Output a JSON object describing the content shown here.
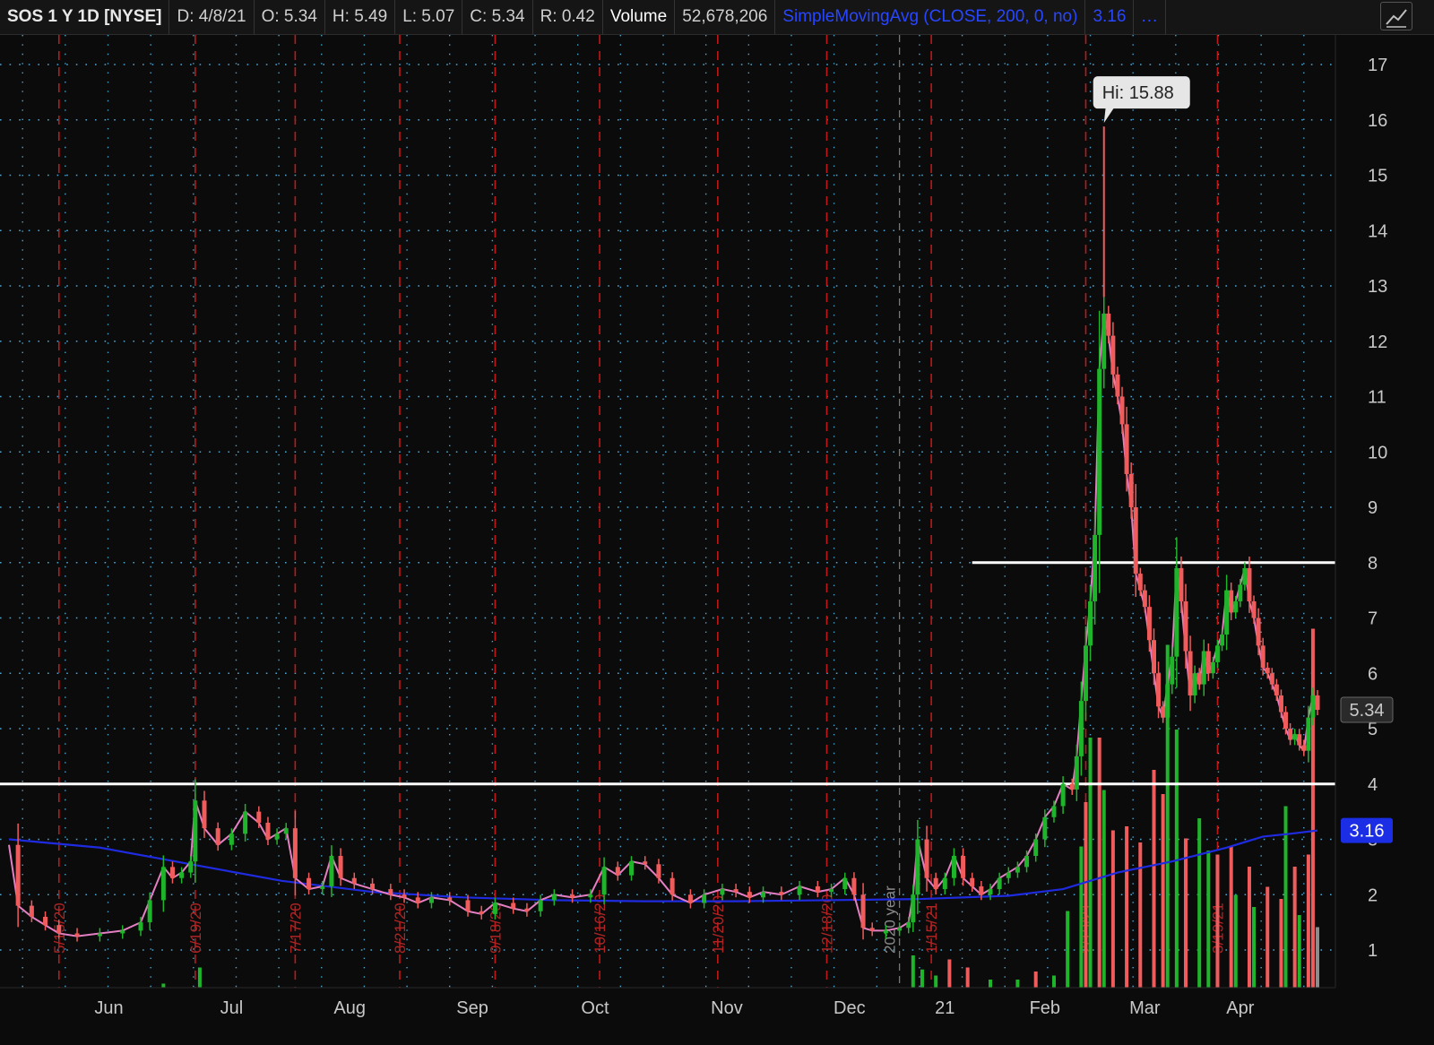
{
  "header": {
    "symbol": "SOS 1 Y 1D [NYSE]",
    "date": "D: 4/8/21",
    "open": "O: 5.34",
    "high": "H: 5.49",
    "low": "L: 5.07",
    "close": "C: 5.34",
    "range": "R: 0.42",
    "volume_label": "Volume",
    "volume_value": "52,678,206",
    "study": "SimpleMovingAvg (CLOSE, 200, 0, no)",
    "study_value": "3.16",
    "more": "..."
  },
  "icons": {
    "study_toggle": "trend-line-icon"
  },
  "colors": {
    "background": "#0b0b0b",
    "up": "#1fb52a",
    "down": "#f05c5c",
    "price_line": "#e47fc3",
    "sma": "#1f2be0",
    "month_line": "#c01818",
    "grid_dots": "#4aa6d4",
    "volume_last": "#8c8c8c"
  },
  "chart_data": {
    "type": "line",
    "symbol": "SOS",
    "ylim": [
      0.3,
      17.6
    ],
    "y_ticks": [
      1,
      2,
      3,
      4,
      5,
      6,
      7,
      8,
      9,
      10,
      11,
      12,
      13,
      14,
      15,
      16,
      17
    ],
    "x_months": [
      "Jun",
      "Jul",
      "Aug",
      "Sep",
      "Oct",
      "Nov",
      "Dec",
      "21",
      "Feb",
      "Mar",
      "Apr"
    ],
    "marker_dates": [
      "5/15/20",
      "6/19/20",
      "7/17/20",
      "8/21/20",
      "9/18/20",
      "10/16/20",
      "11/20/20",
      "12/18/20",
      "1/15/21",
      "2/19/21",
      "3/19/21"
    ],
    "year_marker": "2020 year",
    "close_series": [
      [
        0,
        2.9
      ],
      [
        2,
        1.8
      ],
      [
        5,
        1.6
      ],
      [
        8,
        1.45
      ],
      [
        11,
        1.3
      ],
      [
        15,
        1.25
      ],
      [
        20,
        1.3
      ],
      [
        25,
        1.35
      ],
      [
        29,
        1.5
      ],
      [
        31,
        1.9
      ],
      [
        34,
        2.5
      ],
      [
        36,
        2.3
      ],
      [
        38,
        2.4
      ],
      [
        40,
        2.6
      ],
      [
        41,
        3.7
      ],
      [
        43,
        3.2
      ],
      [
        46,
        2.9
      ],
      [
        49,
        3.1
      ],
      [
        52,
        3.5
      ],
      [
        55,
        3.3
      ],
      [
        57,
        3.0
      ],
      [
        59,
        3.1
      ],
      [
        61,
        3.2
      ],
      [
        63,
        2.3
      ],
      [
        66,
        2.1
      ],
      [
        69,
        2.15
      ],
      [
        71,
        2.7
      ],
      [
        73,
        2.3
      ],
      [
        76,
        2.2
      ],
      [
        80,
        2.1
      ],
      [
        84,
        2.0
      ],
      [
        87,
        1.95
      ],
      [
        90,
        1.85
      ],
      [
        93,
        1.95
      ],
      [
        97,
        1.9
      ],
      [
        101,
        1.7
      ],
      [
        104,
        1.65
      ],
      [
        107,
        1.85
      ],
      [
        111,
        1.75
      ],
      [
        114,
        1.7
      ],
      [
        117,
        1.9
      ],
      [
        120,
        2.0
      ],
      [
        124,
        1.95
      ],
      [
        128,
        2.0
      ],
      [
        131,
        2.5
      ],
      [
        134,
        2.35
      ],
      [
        137,
        2.6
      ],
      [
        140,
        2.55
      ],
      [
        143,
        2.3
      ],
      [
        146,
        2.0
      ],
      [
        150,
        1.85
      ],
      [
        153,
        2.0
      ],
      [
        157,
        2.1
      ],
      [
        160,
        2.05
      ],
      [
        163,
        1.95
      ],
      [
        166,
        2.05
      ],
      [
        170,
        2.0
      ],
      [
        174,
        2.15
      ],
      [
        178,
        2.05
      ],
      [
        181,
        2.1
      ],
      [
        184,
        2.3
      ],
      [
        186,
        2.0
      ],
      [
        188,
        1.4
      ],
      [
        190,
        1.35
      ],
      [
        193,
        1.35
      ],
      [
        196,
        1.4
      ],
      [
        198,
        1.5
      ],
      [
        199,
        2.0
      ],
      [
        200,
        3.0
      ],
      [
        202,
        2.3
      ],
      [
        204,
        2.1
      ],
      [
        206,
        2.3
      ],
      [
        208,
        2.7
      ],
      [
        210,
        2.3
      ],
      [
        212,
        2.15
      ],
      [
        214,
        2.0
      ],
      [
        216,
        2.1
      ],
      [
        218,
        2.3
      ],
      [
        220,
        2.4
      ],
      [
        222,
        2.5
      ],
      [
        224,
        2.7
      ],
      [
        226,
        3.0
      ],
      [
        228,
        3.4
      ],
      [
        230,
        3.6
      ],
      [
        232,
        4.0
      ],
      [
        234,
        3.9
      ],
      [
        235,
        4.5
      ],
      [
        236,
        5.5
      ],
      [
        237,
        6.5
      ],
      [
        238,
        7.3
      ],
      [
        239,
        8.5
      ],
      [
        240,
        11.5
      ],
      [
        241,
        12.5
      ],
      [
        242,
        12.1
      ],
      [
        243,
        11.4
      ],
      [
        244,
        11.0
      ],
      [
        245,
        10.5
      ],
      [
        246,
        9.6
      ],
      [
        247,
        9.0
      ],
      [
        248,
        7.8
      ],
      [
        249,
        7.5
      ],
      [
        250,
        7.2
      ],
      [
        251,
        6.6
      ],
      [
        252,
        6.0
      ],
      [
        253,
        5.4
      ],
      [
        254,
        5.2
      ],
      [
        255,
        5.8
      ],
      [
        256,
        6.3
      ],
      [
        257,
        7.9
      ],
      [
        258,
        7.3
      ],
      [
        259,
        6.4
      ],
      [
        260,
        5.6
      ],
      [
        261,
        6.0
      ],
      [
        262,
        5.8
      ],
      [
        263,
        6.4
      ],
      [
        264,
        6.0
      ],
      [
        265,
        6.2
      ],
      [
        266,
        6.5
      ],
      [
        267,
        6.7
      ],
      [
        268,
        7.5
      ],
      [
        269,
        7.1
      ],
      [
        270,
        7.3
      ],
      [
        271,
        7.6
      ],
      [
        272,
        7.9
      ],
      [
        273,
        7.3
      ],
      [
        274,
        7.0
      ],
      [
        275,
        6.5
      ],
      [
        276,
        6.1
      ],
      [
        277,
        6.0
      ],
      [
        278,
        5.8
      ],
      [
        279,
        5.6
      ],
      [
        280,
        5.3
      ],
      [
        281,
        5.0
      ],
      [
        282,
        4.8
      ],
      [
        283,
        4.9
      ],
      [
        284,
        4.7
      ],
      [
        285,
        4.6
      ],
      [
        286,
        5.2
      ],
      [
        287,
        5.6
      ],
      [
        288,
        5.34
      ]
    ],
    "sma_200": [
      [
        0,
        3.0
      ],
      [
        20,
        2.85
      ],
      [
        40,
        2.55
      ],
      [
        60,
        2.25
      ],
      [
        80,
        2.05
      ],
      [
        100,
        1.95
      ],
      [
        120,
        1.9
      ],
      [
        140,
        1.88
      ],
      [
        160,
        1.88
      ],
      [
        180,
        1.9
      ],
      [
        200,
        1.92
      ],
      [
        220,
        1.98
      ],
      [
        232,
        2.1
      ],
      [
        244,
        2.4
      ],
      [
        256,
        2.6
      ],
      [
        268,
        2.85
      ],
      [
        276,
        3.05
      ],
      [
        282,
        3.1
      ],
      [
        288,
        3.16
      ]
    ],
    "volume_up": [
      [
        34,
        0.1
      ],
      [
        42,
        0.5
      ],
      [
        199,
        0.8
      ],
      [
        201,
        0.45
      ],
      [
        204,
        0.3
      ],
      [
        216,
        0.2
      ],
      [
        222,
        0.2
      ],
      [
        230,
        0.3
      ],
      [
        233,
        1.9
      ],
      [
        236,
        3.5
      ],
      [
        238,
        6.2
      ],
      [
        241,
        4.9
      ],
      [
        255,
        8.5
      ],
      [
        257,
        6.4
      ],
      [
        262,
        4.2
      ],
      [
        264,
        3.4
      ],
      [
        270,
        2.3
      ],
      [
        274,
        2.0
      ],
      [
        281,
        4.5
      ],
      [
        284,
        1.8
      ]
    ],
    "volume_down": [
      [
        207,
        0.7
      ],
      [
        211,
        0.5
      ],
      [
        226,
        0.4
      ],
      [
        237,
        4.6
      ],
      [
        240,
        6.2
      ],
      [
        243,
        3.9
      ],
      [
        246,
        4.0
      ],
      [
        249,
        3.6
      ],
      [
        252,
        5.4
      ],
      [
        254,
        4.8
      ],
      [
        259,
        3.7
      ],
      [
        266,
        3.3
      ],
      [
        269,
        3.5
      ],
      [
        273,
        3.0
      ],
      [
        277,
        2.5
      ],
      [
        280,
        2.2
      ],
      [
        283,
        3.0
      ],
      [
        286,
        3.3
      ],
      [
        287,
        8.9
      ]
    ],
    "volume_last": [
      [
        288,
        1.5
      ]
    ],
    "horizontal_levels": [
      {
        "price": 4,
        "from_day": 0
      },
      {
        "price": 8,
        "from_day": 212
      }
    ],
    "high_callout": {
      "day": 241,
      "price": 15.88,
      "text": "Hi: 15.88"
    },
    "last_price_tag": "5.34",
    "sma_tag": "3.16"
  }
}
